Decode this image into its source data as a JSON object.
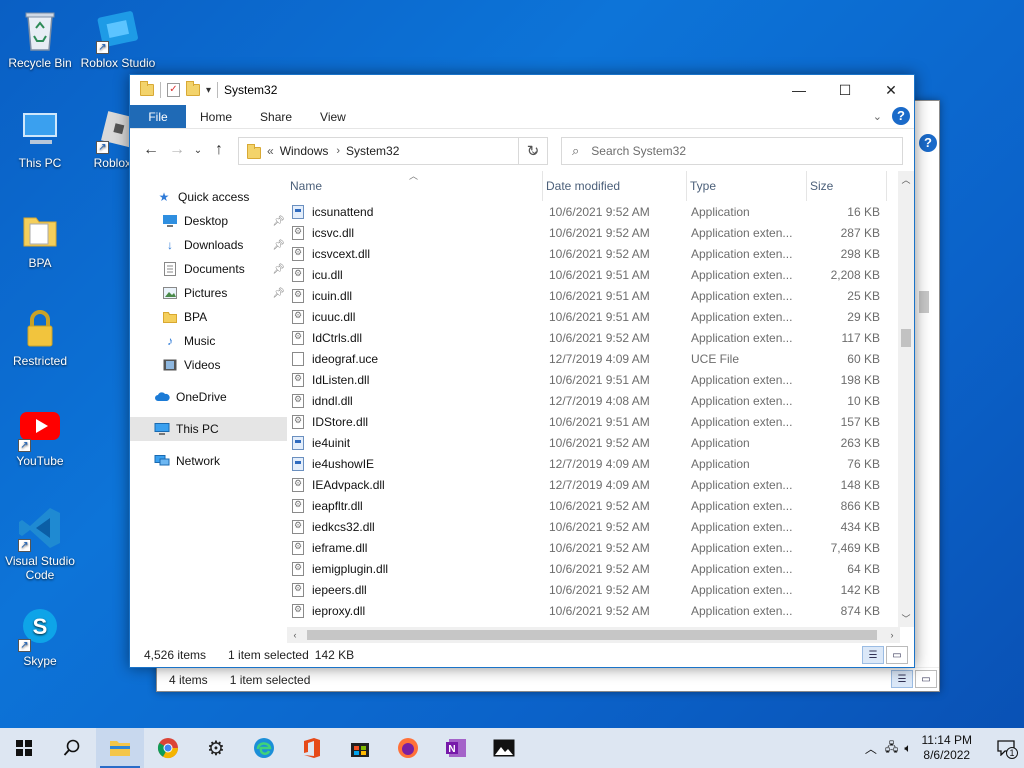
{
  "desktop": {
    "icons": [
      {
        "label": "Recycle Bin",
        "icon": "recycle-bin-icon"
      },
      {
        "label": "Roblox Studio",
        "icon": "roblox-studio-icon"
      },
      {
        "label": "This PC",
        "icon": "this-pc-icon"
      },
      {
        "label": "Roblox P",
        "icon": "roblox-player-icon"
      },
      {
        "label": "BPA",
        "icon": "folder-icon"
      },
      {
        "label": "Restricted",
        "icon": "lock-icon"
      },
      {
        "label": "YouTube",
        "icon": "youtube-icon"
      },
      {
        "label": "Visual Studio Code",
        "icon": "vscode-icon"
      },
      {
        "label": "Skype",
        "icon": "skype-icon"
      }
    ]
  },
  "background_window": {
    "status_items": "4 items",
    "status_selected": "1 item selected"
  },
  "window": {
    "title": "System32",
    "ribbon_tabs": [
      "File",
      "Home",
      "Share",
      "View"
    ],
    "address": {
      "root": "Windows",
      "current": "System32",
      "overflow": "«"
    },
    "search_placeholder": "Search System32",
    "columns": [
      "Name",
      "Date modified",
      "Type",
      "Size"
    ],
    "files": [
      {
        "name": "icsunattend",
        "date": "10/6/2021 9:52 AM",
        "type": "Application",
        "size": "16 KB",
        "kind": "app"
      },
      {
        "name": "icsvc.dll",
        "date": "10/6/2021 9:52 AM",
        "type": "Application exten...",
        "size": "287 KB",
        "kind": "dll"
      },
      {
        "name": "icsvcext.dll",
        "date": "10/6/2021 9:52 AM",
        "type": "Application exten...",
        "size": "298 KB",
        "kind": "dll"
      },
      {
        "name": "icu.dll",
        "date": "10/6/2021 9:51 AM",
        "type": "Application exten...",
        "size": "2,208 KB",
        "kind": "dll"
      },
      {
        "name": "icuin.dll",
        "date": "10/6/2021 9:51 AM",
        "type": "Application exten...",
        "size": "25 KB",
        "kind": "dll"
      },
      {
        "name": "icuuc.dll",
        "date": "10/6/2021 9:51 AM",
        "type": "Application exten...",
        "size": "29 KB",
        "kind": "dll"
      },
      {
        "name": "IdCtrls.dll",
        "date": "10/6/2021 9:52 AM",
        "type": "Application exten...",
        "size": "117 KB",
        "kind": "dll"
      },
      {
        "name": "ideograf.uce",
        "date": "12/7/2019 4:09 AM",
        "type": "UCE File",
        "size": "60 KB",
        "kind": "file"
      },
      {
        "name": "IdListen.dll",
        "date": "10/6/2021 9:51 AM",
        "type": "Application exten...",
        "size": "198 KB",
        "kind": "dll"
      },
      {
        "name": "idndl.dll",
        "date": "12/7/2019 4:08 AM",
        "type": "Application exten...",
        "size": "10 KB",
        "kind": "dll"
      },
      {
        "name": "IDStore.dll",
        "date": "10/6/2021 9:51 AM",
        "type": "Application exten...",
        "size": "157 KB",
        "kind": "dll"
      },
      {
        "name": "ie4uinit",
        "date": "10/6/2021 9:52 AM",
        "type": "Application",
        "size": "263 KB",
        "kind": "app"
      },
      {
        "name": "ie4ushowIE",
        "date": "12/7/2019 4:09 AM",
        "type": "Application",
        "size": "76 KB",
        "kind": "app"
      },
      {
        "name": "IEAdvpack.dll",
        "date": "12/7/2019 4:09 AM",
        "type": "Application exten...",
        "size": "148 KB",
        "kind": "dll"
      },
      {
        "name": "ieapfltr.dll",
        "date": "10/6/2021 9:52 AM",
        "type": "Application exten...",
        "size": "866 KB",
        "kind": "dll"
      },
      {
        "name": "iedkcs32.dll",
        "date": "10/6/2021 9:52 AM",
        "type": "Application exten...",
        "size": "434 KB",
        "kind": "dll"
      },
      {
        "name": "ieframe.dll",
        "date": "10/6/2021 9:52 AM",
        "type": "Application exten...",
        "size": "7,469 KB",
        "kind": "dll"
      },
      {
        "name": "iemigplugin.dll",
        "date": "10/6/2021 9:52 AM",
        "type": "Application exten...",
        "size": "64 KB",
        "kind": "dll"
      },
      {
        "name": "iepeers.dll",
        "date": "10/6/2021 9:52 AM",
        "type": "Application exten...",
        "size": "142 KB",
        "kind": "dll"
      },
      {
        "name": "ieproxy.dll",
        "date": "10/6/2021 9:52 AM",
        "type": "Application exten...",
        "size": "874 KB",
        "kind": "dll"
      }
    ],
    "status": {
      "count": "4,526 items",
      "selected": "1 item selected",
      "size": "142 KB"
    }
  },
  "nav": {
    "quick_access": "Quick access",
    "items": [
      {
        "label": "Desktop",
        "icon": "desktop-icon",
        "pinned": true
      },
      {
        "label": "Downloads",
        "icon": "downloads-icon",
        "pinned": true
      },
      {
        "label": "Documents",
        "icon": "documents-icon",
        "pinned": true
      },
      {
        "label": "Pictures",
        "icon": "pictures-icon",
        "pinned": true
      },
      {
        "label": "BPA",
        "icon": "folder-icon",
        "pinned": false
      },
      {
        "label": "Music",
        "icon": "music-icon",
        "pinned": false
      },
      {
        "label": "Videos",
        "icon": "videos-icon",
        "pinned": false
      }
    ],
    "onedrive": "OneDrive",
    "this_pc": "This PC",
    "network": "Network"
  },
  "taskbar": {
    "apps": [
      "start-icon",
      "search-icon",
      "file-explorer-icon",
      "chrome-icon",
      "settings-icon",
      "edge-icon",
      "office-icon",
      "store-icon",
      "firefox-icon",
      "onenote-icon",
      "photos-icon"
    ],
    "time": "11:14 PM",
    "date": "8/6/2022",
    "notification_count": "1"
  },
  "colors": {
    "accent": "#1f6ab6",
    "desktop": "#0d6fd6",
    "taskbar": "#dde6f2"
  }
}
